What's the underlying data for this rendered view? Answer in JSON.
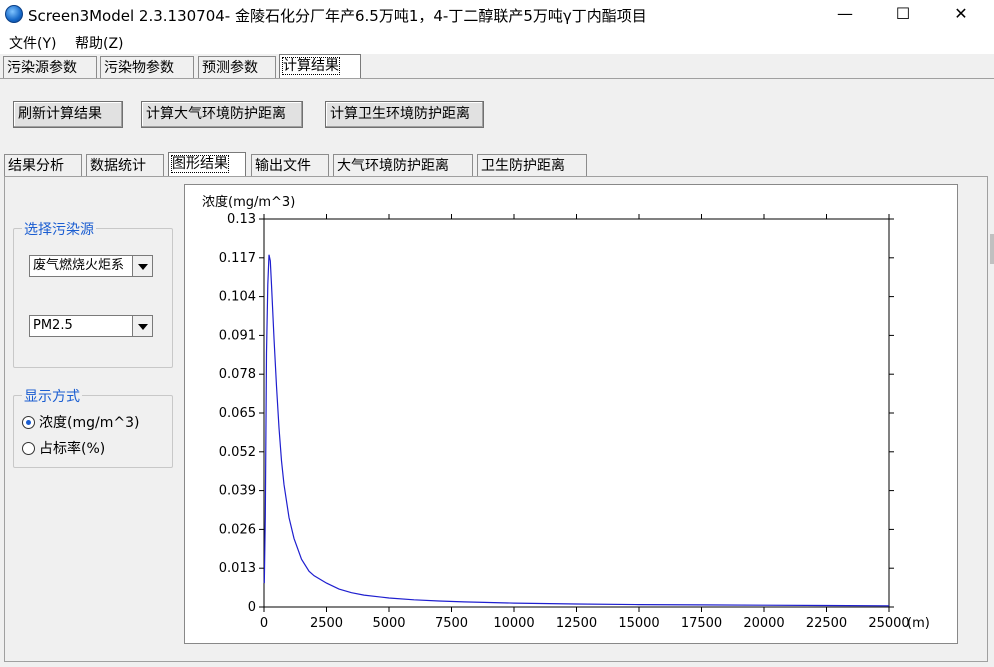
{
  "window": {
    "title": "Screen3Model 2.3.130704- 金陵石化分厂年产6.5万吨1，4-丁二醇联产5万吨γ丁内酯项目",
    "minimize": "—",
    "maximize": "☐",
    "close": "✕"
  },
  "menu": [
    {
      "label": "文件(Y)"
    },
    {
      "label": "帮助(Z)"
    }
  ],
  "main_tabs": [
    {
      "label": "污染源参数"
    },
    {
      "label": "污染物参数"
    },
    {
      "label": "预测参数"
    },
    {
      "label": "计算结果"
    }
  ],
  "toolbar": {
    "refresh": "刷新计算结果",
    "air_distance": "计算大气环境防护距离",
    "health_distance": "计算卫生环境防护距离"
  },
  "sub_tabs": [
    {
      "label": "结果分析"
    },
    {
      "label": "数据统计"
    },
    {
      "label": "图形结果"
    },
    {
      "label": "输出文件"
    },
    {
      "label": "大气环境防护距离"
    },
    {
      "label": "卫生防护距离"
    }
  ],
  "source_group": {
    "legend": "选择污染源",
    "source_value": "废气燃烧火炬系",
    "pollutant_value": "PM2.5"
  },
  "display_group": {
    "legend": "显示方式",
    "opt_concentration": "浓度(mg/m^3)",
    "opt_ratio": "占标率(%)",
    "selected": "concentration"
  },
  "chart_data": {
    "type": "line",
    "ylabel": "浓度(mg/m^3)",
    "xlabel": "(m)",
    "xlim": [
      0,
      25000
    ],
    "ylim": [
      0,
      0.13
    ],
    "x_ticks": [
      0,
      2500,
      5000,
      7500,
      10000,
      12500,
      15000,
      17500,
      20000,
      22500,
      25000
    ],
    "y_ticks": [
      "0",
      "0.013",
      "0.026",
      "0.039",
      "0.052",
      "0.065",
      "0.078",
      "0.091",
      "0.104",
      "0.117",
      "0.13"
    ],
    "y_tick_values": [
      0,
      0.013,
      0.026,
      0.039,
      0.052,
      0.065,
      0.078,
      0.091,
      0.104,
      0.117,
      0.13
    ],
    "series": [
      {
        "color": "#1f1fcf",
        "x": [
          10,
          50,
          100,
          150,
          200,
          250,
          300,
          400,
          500,
          600,
          700,
          800,
          1000,
          1200,
          1500,
          1800,
          2000,
          2500,
          3000,
          3500,
          4000,
          5000,
          6000,
          7000,
          8000,
          9000,
          10000,
          12500,
          15000,
          17500,
          20000,
          22500,
          25000
        ],
        "y": [
          0.008,
          0.03,
          0.085,
          0.108,
          0.118,
          0.116,
          0.108,
          0.09,
          0.074,
          0.06,
          0.049,
          0.041,
          0.03,
          0.023,
          0.016,
          0.012,
          0.0105,
          0.008,
          0.006,
          0.0048,
          0.004,
          0.003,
          0.0024,
          0.002,
          0.0017,
          0.0015,
          0.0013,
          0.001,
          0.0008,
          0.0007,
          0.0006,
          0.0005,
          0.0004
        ]
      }
    ]
  }
}
